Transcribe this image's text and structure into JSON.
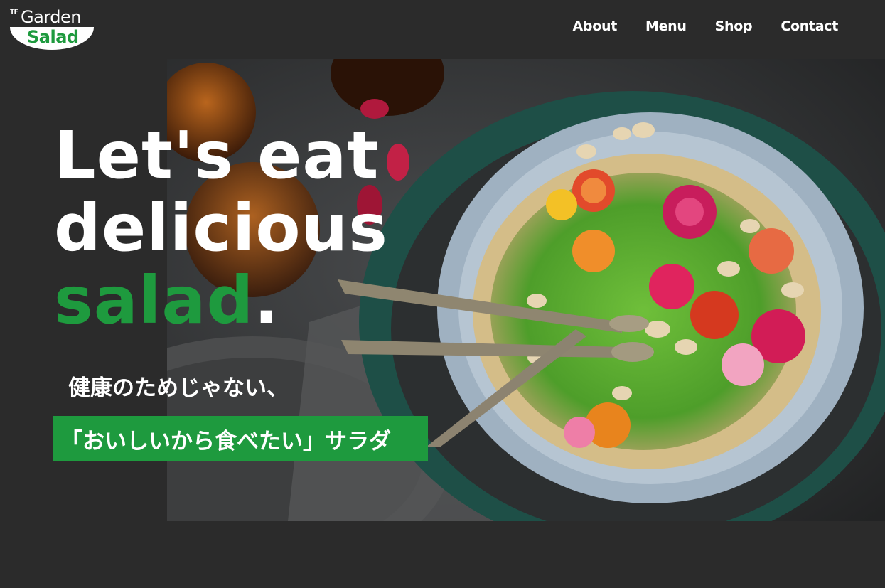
{
  "logo": {
    "prefix": "TF",
    "top_word": "Garden",
    "bottom_word": "Salad",
    "accent": "#1e9a3e"
  },
  "nav": {
    "items": [
      {
        "label": "About"
      },
      {
        "label": "Menu"
      },
      {
        "label": "Shop"
      },
      {
        "label": "Contact"
      }
    ]
  },
  "hero": {
    "headline_line1": "Let's eat",
    "headline_line2": "delicious",
    "headline_line3_green": "salad",
    "headline_line3_dot": ".",
    "subtext": "健康のためじゃない、",
    "tagline": "「おいしいから食べたい」サラダ",
    "image_description_icon": "salad-bowl-photo"
  },
  "colors": {
    "background": "#2b2b2b",
    "accent_green": "#1e9a3e",
    "text": "#ffffff"
  }
}
